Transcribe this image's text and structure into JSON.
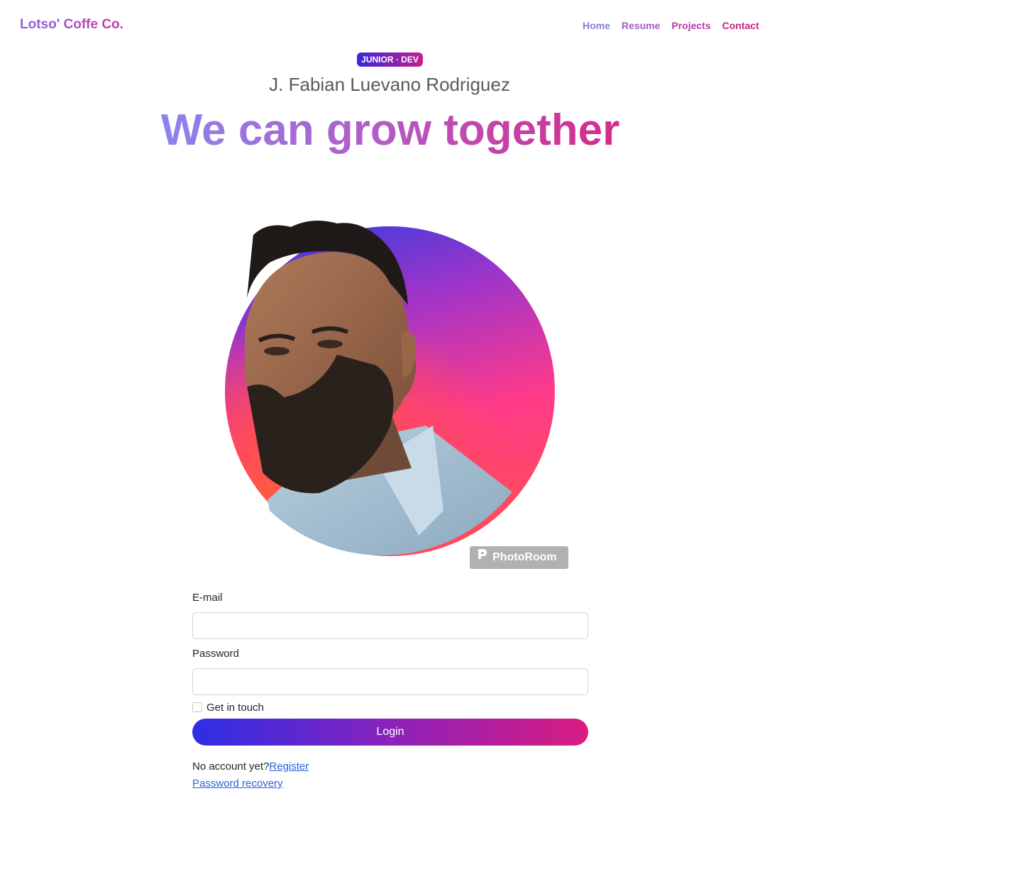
{
  "navbar": {
    "brand": "Lotso' Coffe Co.",
    "links": [
      {
        "label": "Home",
        "color": "#8f7ad8"
      },
      {
        "label": "Resume",
        "color": "#a25cc4"
      },
      {
        "label": "Projects",
        "color": "#b43ea9"
      },
      {
        "label": "Contact",
        "color": "#c5247f"
      }
    ]
  },
  "hero": {
    "badge": "JUNIOR · DEV",
    "name": "J. Fabian Luevano Rodriguez",
    "headline": "We can grow together"
  },
  "portrait": {
    "watermark": "PhotoRoom"
  },
  "login_form": {
    "email_label": "E-mail",
    "email_value": "",
    "password_label": "Password",
    "password_value": "",
    "checkbox_label": "Get in touch",
    "submit_label": "Login",
    "no_account_text": "No account yet?",
    "register_link": "Register",
    "recovery_link": "Password recovery"
  }
}
